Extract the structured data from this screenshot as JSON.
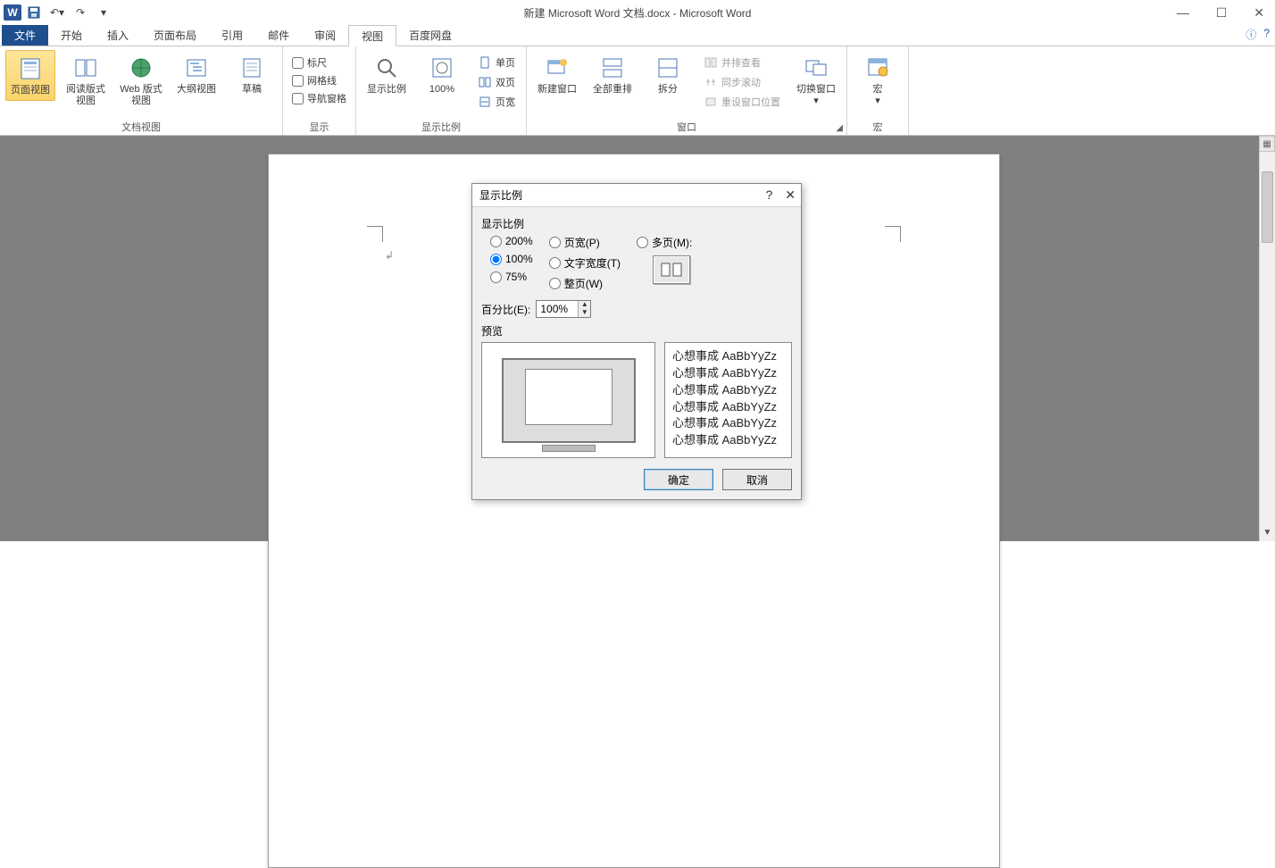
{
  "titlebar": {
    "title": "新建 Microsoft Word 文档.docx - Microsoft Word"
  },
  "tabs": {
    "file": "文件",
    "items": [
      "开始",
      "插入",
      "页面布局",
      "引用",
      "邮件",
      "审阅",
      "视图",
      "百度网盘"
    ],
    "activeIndex": 6
  },
  "ribbon": {
    "group_docviews": {
      "label": "文档视图",
      "items": [
        "页面视图",
        "阅读版式视图",
        "Web 版式视图",
        "大纲视图",
        "草稿"
      ]
    },
    "group_show": {
      "label": "显示",
      "items": [
        "标尺",
        "网格线",
        "导航窗格"
      ]
    },
    "group_zoom": {
      "label": "显示比例",
      "zoom": "显示比例",
      "hundred": "100%",
      "one_page": "单页",
      "two_page": "双页",
      "page_width": "页宽"
    },
    "group_window": {
      "label": "窗口",
      "new_window": "新建窗口",
      "arrange_all": "全部重排",
      "split": "拆分",
      "side_by_side": "并排查看",
      "sync_scroll": "同步滚动",
      "reset_pos": "重设窗口位置",
      "switch": "切换窗口"
    },
    "group_macro": {
      "label": "宏",
      "macro": "宏"
    }
  },
  "dialog": {
    "title": "显示比例",
    "section": "显示比例",
    "r200": "200%",
    "r100": "100%",
    "r75": "75%",
    "page_width": "页宽(P)",
    "text_width": "文字宽度(T)",
    "whole_page": "整页(W)",
    "multi_page": "多页(M):",
    "percent_label": "百分比(E):",
    "percent_value": "100%",
    "preview_label": "预览",
    "sample_line": "心想事成 AaBbYyZz",
    "ok": "确定",
    "cancel": "取消"
  }
}
